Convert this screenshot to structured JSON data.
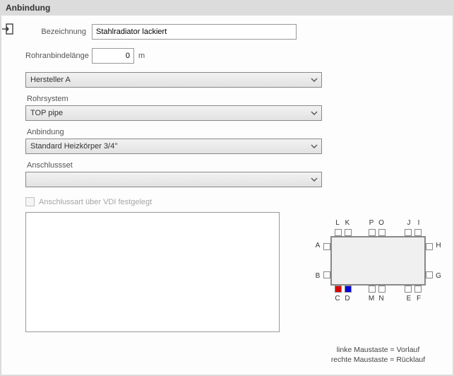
{
  "header": {
    "title": "Anbindung"
  },
  "form": {
    "bezeichnung_label": "Bezeichnung",
    "bezeichnung_value": "Stahlradiator lackiert",
    "rohranbind_label": "Rohranbindelänge",
    "rohranbind_value": "0",
    "rohranbind_unit": "m",
    "hersteller_label": "",
    "hersteller_value": "Hersteller A",
    "rohrsystem_label": "Rohrsystem",
    "rohrsystem_value": "TOP pipe",
    "anbindung_label": "Anbindung",
    "anbindung_value": "Standard Heizkörper 3/4''",
    "anschlussset_label": "Anschlussset",
    "anschlussset_value": "",
    "vdi_checkbox_label": "Anschlussart über VDI festgelegt",
    "vdi_checked": false
  },
  "radiator": {
    "top": {
      "L": "L",
      "K": "K",
      "P": "P",
      "O": "O",
      "J": "J",
      "I": "I"
    },
    "left": {
      "A": "A",
      "B": "B"
    },
    "right": {
      "H": "H",
      "G": "G"
    },
    "bottom": {
      "C": "C",
      "D": "D",
      "M": "M",
      "N": "N",
      "E": "E",
      "F": "F"
    },
    "hint1": "linke Maustaste = Vorlauf",
    "hint2": "rechte Maustaste = Rücklauf"
  }
}
